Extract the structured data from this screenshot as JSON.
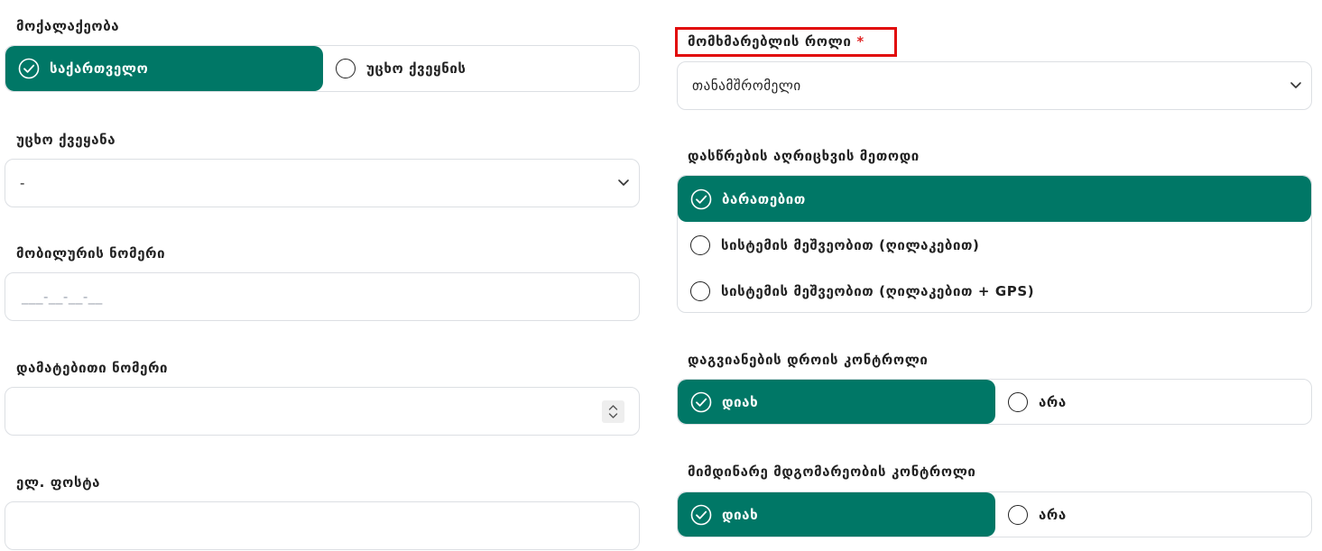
{
  "left": {
    "citizenship": {
      "label": "მოქალაქეობა",
      "options": [
        "საქართველო",
        "უცხო ქვეყნის"
      ],
      "selected": 0
    },
    "foreign_country": {
      "label": "უცხო ქვეყანა",
      "value": "-"
    },
    "mobile_number": {
      "label": "მობილურის ნომერი",
      "placeholder": "___-__-__-__"
    },
    "extra_number": {
      "label": "დამატებითი ნომერი",
      "value": ""
    },
    "email": {
      "label": "ელ. ფოსტა",
      "value": ""
    }
  },
  "right": {
    "user_role": {
      "label": "მომხმარებლის როლი",
      "required_mark": "*",
      "value": "თანამშრომელი"
    },
    "attendance_method": {
      "label": "დასწრების აღრიცხვის მეთოდი",
      "options": [
        "ბარათებით",
        "სისტემის მეშვეობით (ღილაკებით)",
        "სისტემის მეშვეობით (ღილაკებით + GPS)"
      ],
      "selected": 0
    },
    "late_control": {
      "label": "დაგვიანების დროის კონტროლი",
      "options": [
        "დიახ",
        "არა"
      ],
      "selected": 0
    },
    "status_control": {
      "label": "მიმდინარე მდგომარეობის კონტროლი",
      "options": [
        "დიახ",
        "არა"
      ],
      "selected": 0
    }
  },
  "colors": {
    "accent": "#007766",
    "highlight_border": "#e10b0b",
    "required": "#e02424"
  },
  "icons": {
    "checked": "check-circle-icon",
    "unchecked": "radio-empty-icon",
    "dropdown": "chevron-down-icon",
    "stepper": "stepper-icon"
  }
}
